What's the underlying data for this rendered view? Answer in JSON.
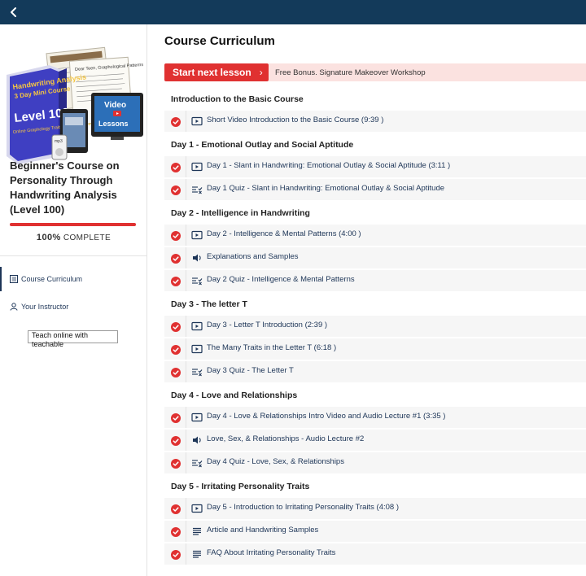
{
  "topbar": {
    "back_icon": "chevron-left-icon"
  },
  "sidebar": {
    "cover": {
      "box_title_line1": "Handwriting Analysis",
      "box_title_line2": "3 Day Mini Course",
      "level_text": "Level 100",
      "box_subtitle": "Online Graphology Traits Course for Beginners",
      "video_label": "Video",
      "lessons_label": "Lessons",
      "mp3_label": "mp3",
      "paper_text": "Dear Teen, Graphological Patterns"
    },
    "course_title": "Beginner's Course on Personality Through Handwriting Analysis (Level 100)",
    "progress": {
      "percent_text": "100%",
      "complete_text": "COMPLETE",
      "fraction": 1.0,
      "color": "#e03131"
    },
    "nav": [
      {
        "label": "Course Curriculum",
        "icon": "list-icon",
        "active": true
      },
      {
        "label": "Your Instructor",
        "icon": "user-icon",
        "active": false
      }
    ],
    "teach_text": "Teach online with teachable"
  },
  "main": {
    "title": "Course Curriculum",
    "start_button": "Start next lesson",
    "start_chevron": "›",
    "bonus_text": "Free Bonus. Signature Makeover Workshop",
    "accent_color": "#e03131",
    "sections": [
      {
        "title": "Introduction to the Basic Course",
        "lessons": [
          {
            "type": "video",
            "title": "Short Video Introduction to the Basic Course (9:39 )"
          }
        ]
      },
      {
        "title": "Day 1 - Emotional Outlay and Social Aptitude",
        "lessons": [
          {
            "type": "video",
            "title": "Day 1 - Slant in Handwriting: Emotional Outlay & Social Aptitude (3:11 )"
          },
          {
            "type": "quiz",
            "title": "Day 1 Quiz - Slant in Handwriting: Emotional Outlay & Social Aptitude"
          }
        ]
      },
      {
        "title": "Day 2 - Intelligence in Handwriting",
        "lessons": [
          {
            "type": "video",
            "title": "Day 2 - Intelligence & Mental Patterns (4:00 )"
          },
          {
            "type": "audio",
            "title": "Explanations and Samples"
          },
          {
            "type": "quiz",
            "title": "Day 2 Quiz - Intelligence & Mental Patterns"
          }
        ]
      },
      {
        "title": "Day 3 - The letter T",
        "lessons": [
          {
            "type": "video",
            "title": "Day 3 - Letter T Introduction (2:39 )"
          },
          {
            "type": "video",
            "title": "The Many Traits in the Letter T (6:18 )"
          },
          {
            "type": "quiz",
            "title": "Day 3 Quiz - The Letter T"
          }
        ]
      },
      {
        "title": "Day 4 - Love and Relationships",
        "lessons": [
          {
            "type": "video",
            "title": "Day 4 - Love & Relationships Intro Video and Audio Lecture #1 (3:35 )"
          },
          {
            "type": "audio",
            "title": "Love, Sex, & Relationships - Audio Lecture #2"
          },
          {
            "type": "quiz",
            "title": "Day 4 Quiz - Love, Sex, & Relationships"
          }
        ]
      },
      {
        "title": "Day 5 - Irritating Personality Traits",
        "lessons": [
          {
            "type": "video",
            "title": "Day 5 - Introduction to Irritating Personality Traits (4:08 )"
          },
          {
            "type": "text",
            "title": "Article and Handwriting Samples"
          },
          {
            "type": "text",
            "title": "FAQ About Irritating Personality Traits"
          }
        ]
      }
    ]
  }
}
